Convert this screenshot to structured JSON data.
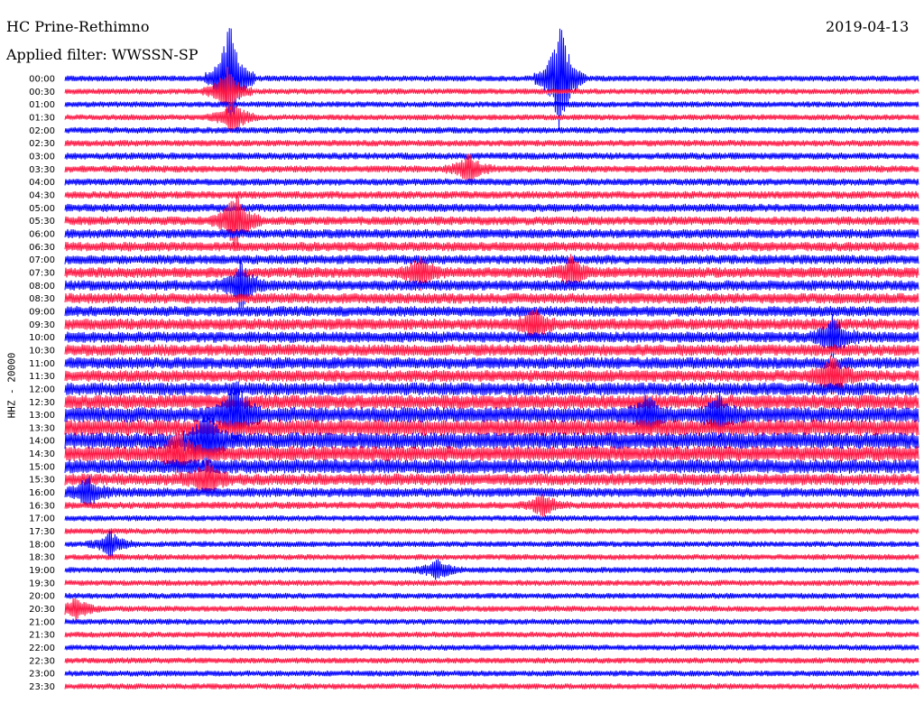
{
  "header": {
    "station": "HC Prine-Rethimno",
    "date": "2019-04-13",
    "filter": "Applied filter: WWSSN-SP",
    "yaxis_label": "HHZ - 20000"
  },
  "colors": {
    "trace_a": "#0000ff",
    "trace_b": "#ff1744",
    "background": "#ffffff",
    "text": "#000000"
  },
  "chart_data": {
    "type": "line",
    "title": "HC Prine-Rethimno",
    "ylabel": "HHZ - 20000",
    "grid": false,
    "legend": "none",
    "minutes_per_line": 30,
    "rows": [
      "00:00",
      "00:30",
      "01:00",
      "01:30",
      "02:00",
      "02:30",
      "03:00",
      "03:30",
      "04:00",
      "04:30",
      "05:00",
      "05:30",
      "06:00",
      "06:30",
      "07:00",
      "07:30",
      "08:00",
      "08:30",
      "09:00",
      "09:30",
      "10:00",
      "10:30",
      "11:00",
      "11:30",
      "12:00",
      "12:30",
      "13:00",
      "13:30",
      "14:00",
      "14:30",
      "15:00",
      "15:30",
      "16:00",
      "16:30",
      "17:00",
      "17:30",
      "18:00",
      "18:30",
      "19:00",
      "19:30",
      "20:00",
      "20:30",
      "21:00",
      "21:30",
      "22:00",
      "22:30",
      "23:00",
      "23:30"
    ],
    "row_colors": [
      "trace_a",
      "trace_b"
    ],
    "noise_level": [
      0.5,
      0.5,
      0.5,
      0.5,
      0.55,
      0.55,
      0.6,
      0.6,
      0.6,
      0.65,
      0.7,
      0.75,
      0.8,
      0.8,
      0.8,
      0.9,
      0.9,
      0.9,
      0.9,
      0.95,
      0.95,
      1.0,
      1.0,
      1.0,
      1.1,
      1.2,
      1.3,
      1.4,
      1.4,
      1.3,
      1.2,
      1.0,
      0.8,
      0.6,
      0.5,
      0.5,
      0.5,
      0.5,
      0.5,
      0.5,
      0.5,
      0.5,
      0.5,
      0.5,
      0.5,
      0.5,
      0.5,
      0.5
    ],
    "events": [
      {
        "row": 0,
        "minute": 5.8,
        "amplitude": 10.0
      },
      {
        "row": 0,
        "minute": 17.4,
        "amplitude": 10.0
      },
      {
        "row": 1,
        "minute": 5.7,
        "amplitude": 4.0
      },
      {
        "row": 3,
        "minute": 5.9,
        "amplitude": 3.0
      },
      {
        "row": 7,
        "minute": 14.2,
        "amplitude": 2.5
      },
      {
        "row": 11,
        "minute": 6.0,
        "amplitude": 5.0
      },
      {
        "row": 15,
        "minute": 12.5,
        "amplitude": 2.5
      },
      {
        "row": 15,
        "minute": 17.8,
        "amplitude": 2.5
      },
      {
        "row": 16,
        "minute": 6.2,
        "amplitude": 4.0
      },
      {
        "row": 19,
        "minute": 16.5,
        "amplitude": 2.5
      },
      {
        "row": 20,
        "minute": 27.0,
        "amplitude": 3.5
      },
      {
        "row": 23,
        "minute": 27.0,
        "amplitude": 3.5
      },
      {
        "row": 26,
        "minute": 6.0,
        "amplitude": 6.0
      },
      {
        "row": 26,
        "minute": 20.5,
        "amplitude": 3.0
      },
      {
        "row": 26,
        "minute": 23.0,
        "amplitude": 3.0
      },
      {
        "row": 28,
        "minute": 5.0,
        "amplitude": 5.0
      },
      {
        "row": 29,
        "minute": 4.0,
        "amplitude": 4.0
      },
      {
        "row": 31,
        "minute": 5.0,
        "amplitude": 3.0
      },
      {
        "row": 32,
        "minute": 0.8,
        "amplitude": 2.5
      },
      {
        "row": 33,
        "minute": 16.8,
        "amplitude": 2.0
      },
      {
        "row": 36,
        "minute": 1.6,
        "amplitude": 2.0
      },
      {
        "row": 38,
        "minute": 13.1,
        "amplitude": 1.8
      },
      {
        "row": 41,
        "minute": 0.4,
        "amplitude": 2.0
      }
    ]
  }
}
